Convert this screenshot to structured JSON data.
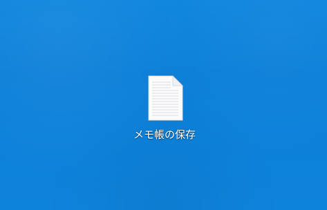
{
  "desktop": {
    "background_color": "#0b7fd8",
    "icon": {
      "type_icon": "text-document-icon",
      "label": "メモ帳の保存"
    }
  }
}
